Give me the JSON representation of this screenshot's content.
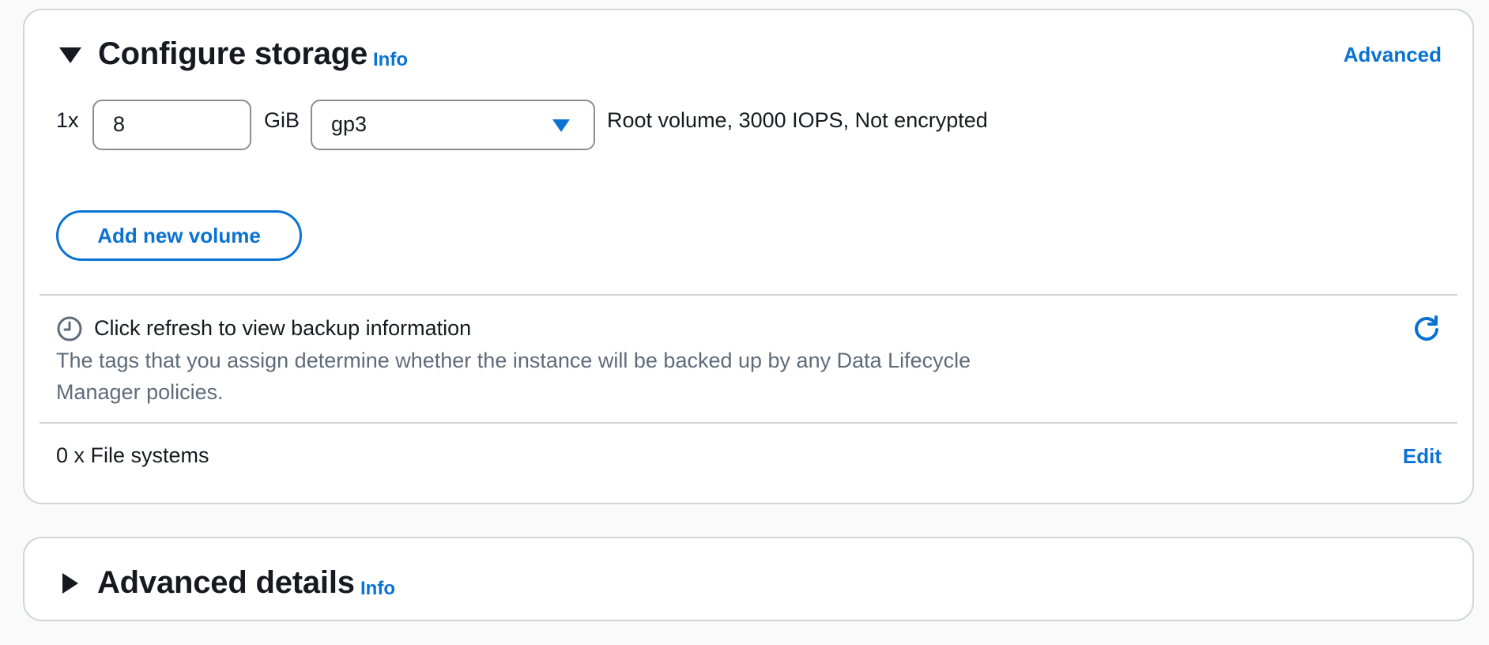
{
  "configure_storage": {
    "title": "Configure storage",
    "info_label": "Info",
    "advanced_link": "Advanced",
    "volume": {
      "count_label": "1x",
      "size_value": "8",
      "unit_label": "GiB",
      "type_value": "gp3",
      "summary": "Root volume,  3000 IOPS,  Not encrypted"
    },
    "add_volume_label": "Add new volume",
    "backup": {
      "title": "Click refresh to view backup information",
      "description": "The tags that you assign determine whether the instance will be backed up by any Data Lifecycle Manager policies.",
      "clock_icon": "clock-icon",
      "refresh_icon": "refresh-icon"
    },
    "file_systems_label": "0 x File systems",
    "edit_label": "Edit"
  },
  "advanced_details": {
    "title": "Advanced details",
    "info_label": "Info"
  },
  "colors": {
    "link": "#0972d3",
    "text": "#16191f",
    "muted": "#5f6b7a",
    "border": "#d1d5db"
  }
}
